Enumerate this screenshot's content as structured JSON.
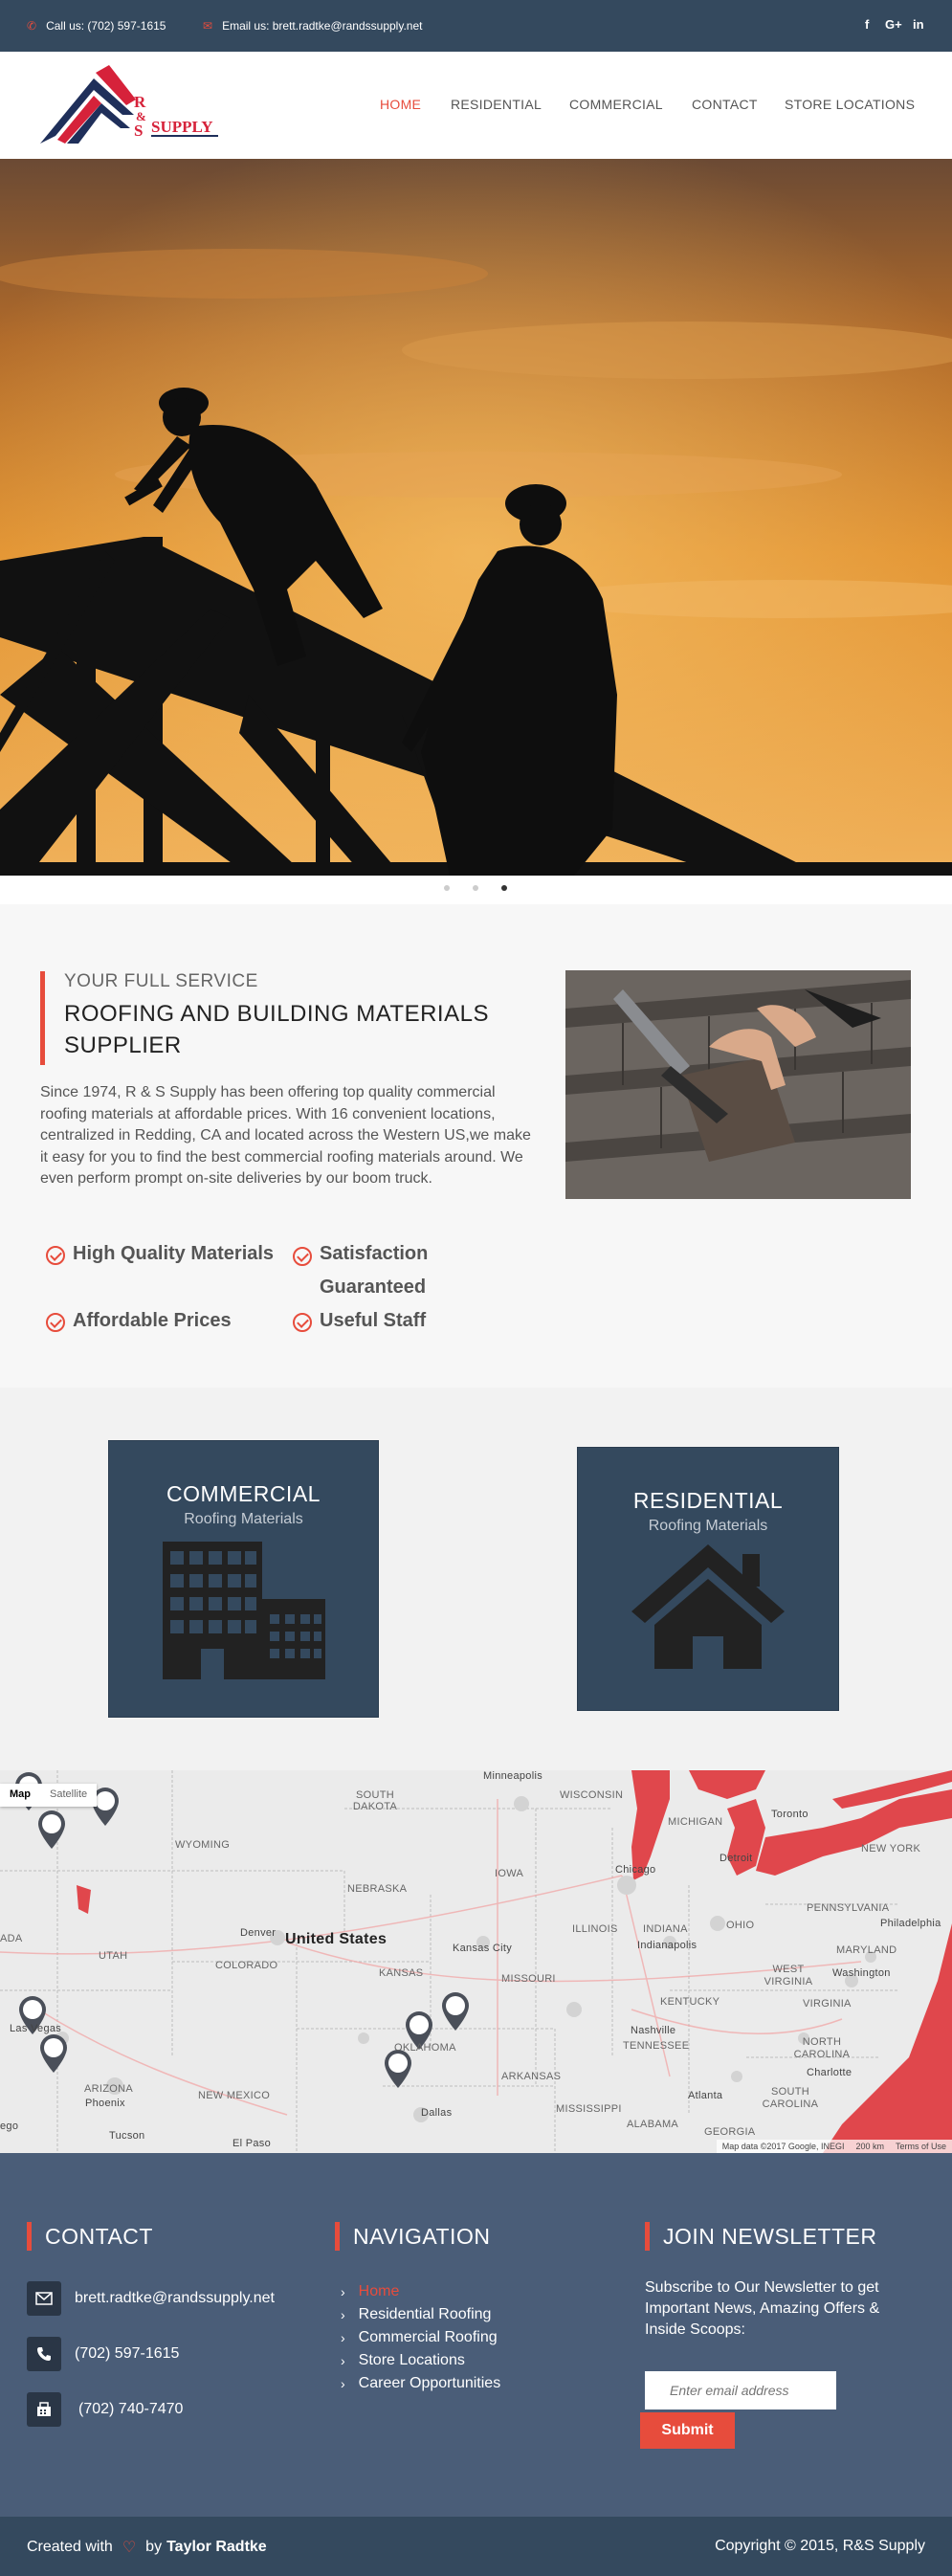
{
  "topbar": {
    "call": "Call us: (702) 597-1615",
    "email": "Email us: brett.radtke@randssupply.net",
    "social": [
      "f",
      "G+",
      "in"
    ]
  },
  "logo": {
    "text": "R & S",
    "supply": "SUPPLY"
  },
  "nav": [
    "HOME",
    "RESIDENTIAL",
    "COMMERCIAL",
    "CONTACT",
    "STORE LOCATIONS"
  ],
  "about": {
    "sub": "YOUR FULL SERVICE",
    "title": "ROOFING AND BUILDING MATERIALS SUPPLIER",
    "text": "Since 1974, R & S Supply has been offering top quality commercial roofing materials at affordable prices. With 16 convenient locations, centralized in Redding, CA and located across the Western US,we make it easy for you to find the best commercial roofing materials around. We even perform prompt on-site deliveries by our boom truck.",
    "features": [
      "High Quality Materials",
      "Satisfaction Guaranteed",
      "Affordable Prices",
      "Useful Staff"
    ]
  },
  "categories": {
    "commercial": {
      "title": "COMMERCIAL",
      "sub": "Roofing Materials"
    },
    "residential": {
      "title": "RESIDENTIAL",
      "sub": "Roofing Materials"
    }
  },
  "map": {
    "types": [
      "Map",
      "Satellite"
    ],
    "country": "United States",
    "states": [
      "SOUTH DAKOTA",
      "WISCONSIN",
      "MICHIGAN",
      "WYOMING",
      "IOWA",
      "NEBRASKA",
      "ILLINOIS",
      "INDIANA",
      "OHIO",
      "PENNSYLVANIA",
      "NEW YORK",
      "UTAH",
      "COLORADO",
      "KANSAS",
      "MISSOURI",
      "KENTUCKY",
      "WEST VIRGINIA",
      "VIRGINIA",
      "MARYLAND",
      "TENNESSEE",
      "NORTH CAROLINA",
      "SOUTH CAROLINA",
      "OKLAHOMA",
      "ARKANSAS",
      "ARIZONA",
      "NEW MEXICO",
      "MISSISSIPPI",
      "ALABAMA",
      "GEORGIA",
      "ADA"
    ],
    "cities": [
      "Minneapolis",
      "Toronto",
      "Detroit",
      "Chicago",
      "Denver",
      "Kansas City",
      "Indianapolis",
      "Philadelphia",
      "Washington",
      "Nashville",
      "Charlotte",
      "Atlanta",
      "Dallas",
      "Phoenix",
      "Tucson",
      "El Paso",
      "Las Vegas",
      "ego"
    ],
    "footer": [
      "Map data ©2017 Google, INEGI",
      "200 km",
      "Terms of Use"
    ]
  },
  "footer": {
    "contact_title": "CONTACT",
    "nav_title": "NAVIGATION",
    "news_title": "JOIN NEWSLETTER",
    "email": "brett.radtke@randssupply.net",
    "phone": "(702) 597-1615",
    "fax": "(702) 740-7470",
    "links": [
      "Home",
      "Residential Roofing",
      "Commercial Roofing",
      "Store Locations",
      "Career Opportunities"
    ],
    "news_text": "Subscribe to Our Newsletter to get Important News, Amazing Offers & Inside Scoops:",
    "placeholder": "Enter email address",
    "submit": "Submit"
  },
  "bottom": {
    "created": "Created with",
    "by": "by",
    "author": "Taylor Radtke",
    "copyright": "Copyright © 2015, R&S Supply"
  },
  "colors": {
    "accent": "#e74c3c",
    "dark": "#34495e",
    "footer": "#4a5d78"
  }
}
